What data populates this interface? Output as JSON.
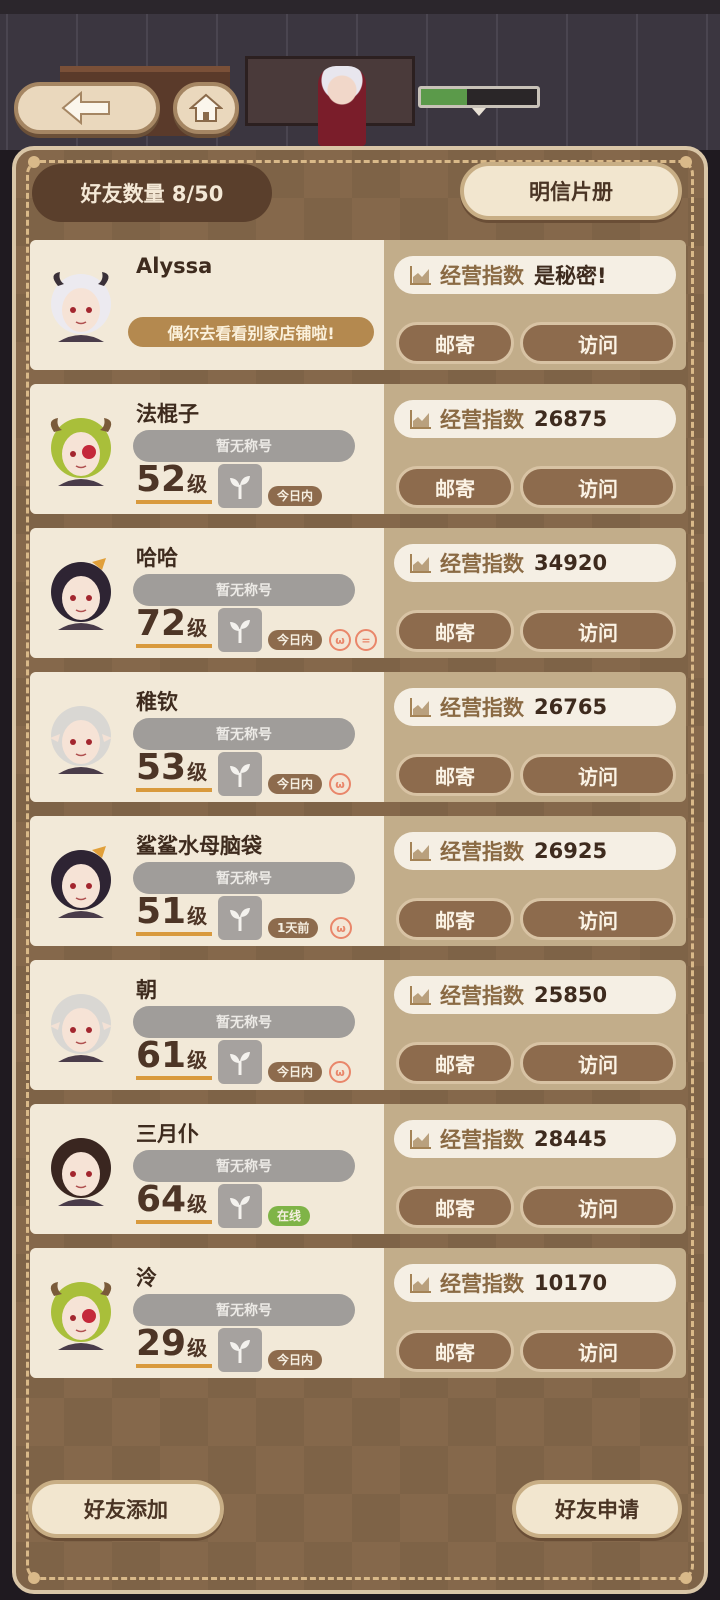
{
  "top": {
    "progress": 0.4
  },
  "header": {
    "friend_count": "好友数量 8/50",
    "album_label": "明信片册"
  },
  "friends": [
    {
      "name": "Alyssa",
      "motto": "偶尔去看看别家店铺啦!",
      "biz_label": "经营指数",
      "biz_value": "是秘密!",
      "mail": "邮寄",
      "visit": "访问",
      "avatar": "white-hair-horned-avatar"
    },
    {
      "name": "法棍子",
      "title": "暂无称号",
      "level": "52",
      "level_unit": "级",
      "status": "今日内",
      "biz_label": "经营指数",
      "biz_value": "26875",
      "mail": "邮寄",
      "visit": "访问",
      "avatar": "green-hair-eyepatch-avatar"
    },
    {
      "name": "哈哈",
      "title": "暂无称号",
      "level": "72",
      "level_unit": "级",
      "status": "今日内",
      "biz_label": "经营指数",
      "biz_value": "34920",
      "mail": "邮寄",
      "visit": "访问",
      "avatar": "dark-hair-ribbon-avatar"
    },
    {
      "name": "稚钦",
      "title": "暂无称号",
      "level": "53",
      "level_unit": "级",
      "status": "今日内",
      "biz_label": "经营指数",
      "biz_value": "26765",
      "mail": "邮寄",
      "visit": "访问",
      "avatar": "silver-hair-elf-avatar"
    },
    {
      "name": "鲨鲨水母脑袋",
      "title": "暂无称号",
      "level": "51",
      "level_unit": "级",
      "status": "1天前",
      "biz_label": "经营指数",
      "biz_value": "26925",
      "mail": "邮寄",
      "visit": "访问",
      "avatar": "dark-hair-ribbon-avatar"
    },
    {
      "name": "朝",
      "title": "暂无称号",
      "level": "61",
      "level_unit": "级",
      "status": "今日内",
      "biz_label": "经营指数",
      "biz_value": "25850",
      "mail": "邮寄",
      "visit": "访问",
      "avatar": "silver-hair-elf-avatar"
    },
    {
      "name": "三月仆",
      "title": "暂无称号",
      "level": "64",
      "level_unit": "级",
      "status": "在线",
      "biz_label": "经营指数",
      "biz_value": "28445",
      "mail": "邮寄",
      "visit": "访问",
      "avatar": "brown-hair-boy-avatar"
    },
    {
      "name": "泠",
      "title": "暂无称号",
      "level": "29",
      "level_unit": "级",
      "status": "今日内",
      "biz_label": "经营指数",
      "biz_value": "10170",
      "mail": "邮寄",
      "visit": "访问",
      "avatar": "green-hair-eyepatch-avatar"
    }
  ],
  "footer": {
    "add_label": "好友添加",
    "request_label": "好友申请"
  },
  "colors": {
    "panel": "#85684b",
    "card": "#f2e9d8",
    "accent": "#d99a3d",
    "online": "#7fb447"
  }
}
